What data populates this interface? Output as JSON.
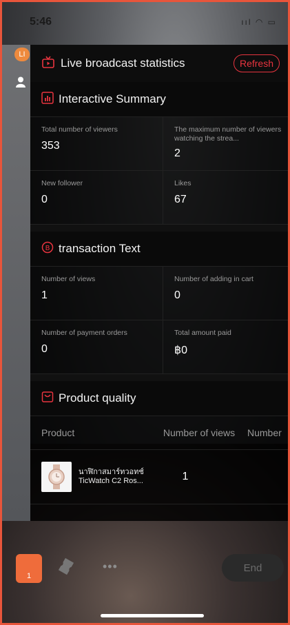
{
  "status_bar": {
    "time": "5:46",
    "icons": "ııl ◠ ▭"
  },
  "side": {
    "badge": "LI"
  },
  "panel": {
    "title": "Live broadcast statistics",
    "refresh_label": "Refresh",
    "interactive": {
      "title": "Interactive Summary",
      "cells": [
        {
          "label": "Total number of viewers",
          "value": "353"
        },
        {
          "label": "The maximum number of viewers watching the strea...",
          "value": "2"
        },
        {
          "label": "New follower",
          "value": "0"
        },
        {
          "label": "Likes",
          "value": "67"
        }
      ]
    },
    "transaction": {
      "title": "transaction  Text",
      "cells": [
        {
          "label": "Number of views",
          "value": "1"
        },
        {
          "label": "Number of adding in cart",
          "value": "0"
        },
        {
          "label": "Number of payment orders",
          "value": "0"
        },
        {
          "label": "Total amount paid",
          "value": "฿0"
        }
      ]
    },
    "product": {
      "title": "Product quality",
      "headers": {
        "product": "Product",
        "views": "Number of views",
        "number": "Number"
      },
      "rows": [
        {
          "name_line1": "นาฬิกาสมาร์ทวอทช์",
          "name_line2": "TicWatch C2 Ros...",
          "views": "1"
        }
      ]
    }
  },
  "bottom": {
    "cart_count": "1",
    "more": "•••",
    "end_label": "End"
  },
  "colors": {
    "accent_red": "#e9343f",
    "cart_orange": "#ef6c3b",
    "frame": "#e8553b"
  }
}
